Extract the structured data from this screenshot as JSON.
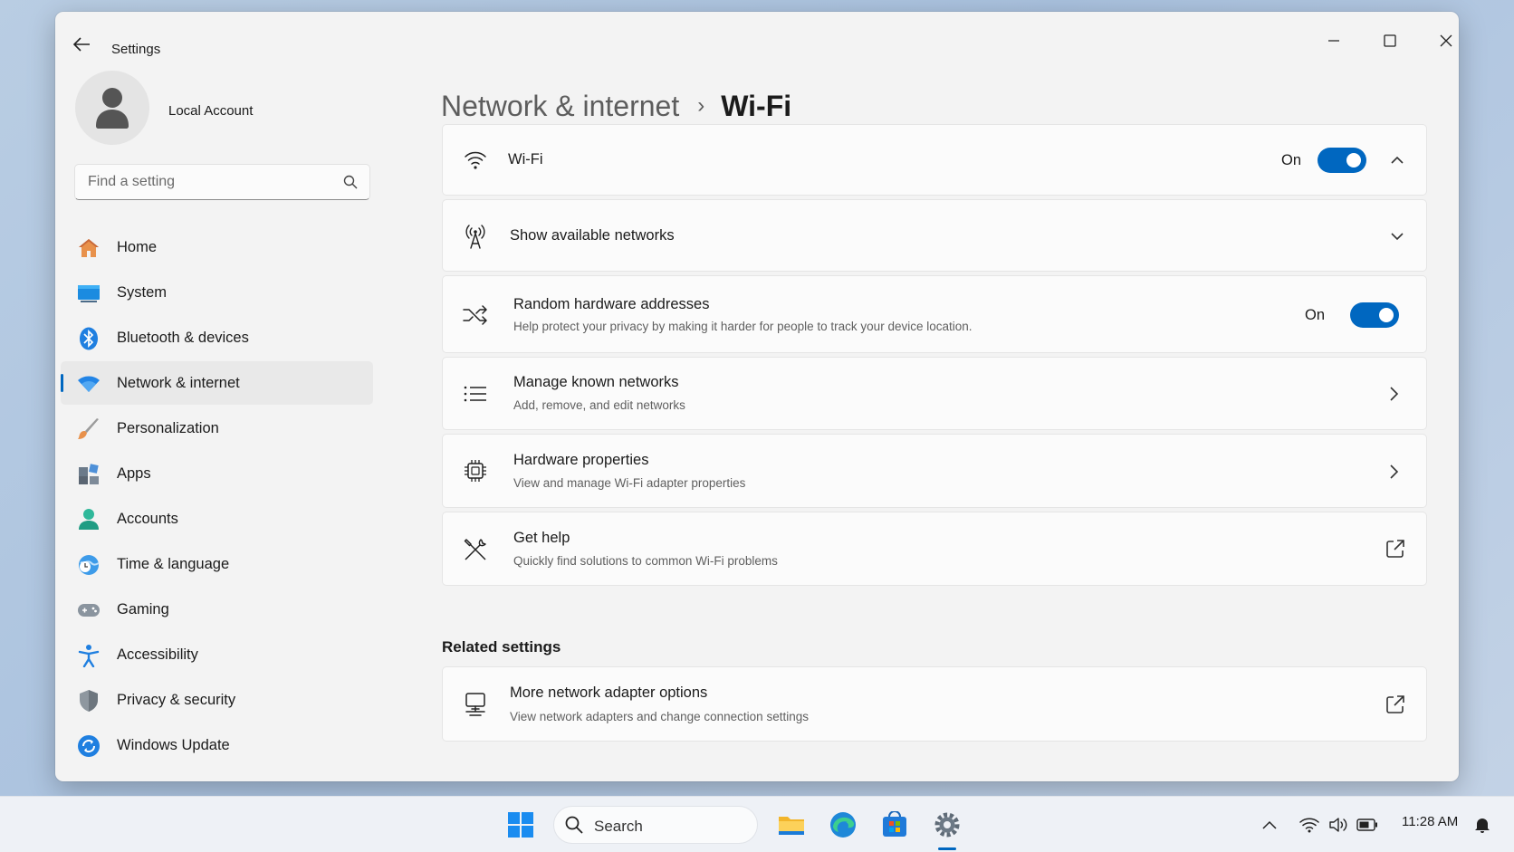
{
  "window": {
    "title": "Settings"
  },
  "profile": {
    "name": "Local Account"
  },
  "search": {
    "placeholder": "Find a setting"
  },
  "sidebar": {
    "items": [
      {
        "label": "Home",
        "icon": "home-icon"
      },
      {
        "label": "System",
        "icon": "system-icon"
      },
      {
        "label": "Bluetooth & devices",
        "icon": "bluetooth-icon"
      },
      {
        "label": "Network & internet",
        "icon": "wifi-icon",
        "active": true
      },
      {
        "label": "Personalization",
        "icon": "brush-icon"
      },
      {
        "label": "Apps",
        "icon": "apps-icon"
      },
      {
        "label": "Accounts",
        "icon": "accounts-icon"
      },
      {
        "label": "Time & language",
        "icon": "globe-clock-icon"
      },
      {
        "label": "Gaming",
        "icon": "gamepad-icon"
      },
      {
        "label": "Accessibility",
        "icon": "accessibility-icon"
      },
      {
        "label": "Privacy & security",
        "icon": "shield-icon"
      },
      {
        "label": "Windows Update",
        "icon": "update-icon"
      }
    ]
  },
  "breadcrumb": {
    "parent": "Network & internet",
    "separator": "›",
    "current": "Wi-Fi"
  },
  "cards": {
    "wifi": {
      "title": "Wi-Fi",
      "state": "On"
    },
    "available": {
      "title": "Show available networks"
    },
    "random_hw": {
      "title": "Random hardware addresses",
      "subtitle": "Help protect your privacy by making it harder for people to track your device location.",
      "state": "On"
    },
    "known": {
      "title": "Manage known networks",
      "subtitle": "Add, remove, and edit networks"
    },
    "hw_props": {
      "title": "Hardware properties",
      "subtitle": "View and manage Wi-Fi adapter properties"
    },
    "help": {
      "title": "Get help",
      "subtitle": "Quickly find solutions to common Wi-Fi problems"
    }
  },
  "related": {
    "header": "Related settings",
    "adapter": {
      "title": "More network adapter options",
      "subtitle": "View network adapters and change connection settings"
    }
  },
  "taskbar": {
    "search_label": "Search",
    "time": "11:28 AM"
  },
  "colors": {
    "accent": "#0067c0",
    "window_bg": "#f3f3f3",
    "card_bg": "#fbfbfb"
  }
}
